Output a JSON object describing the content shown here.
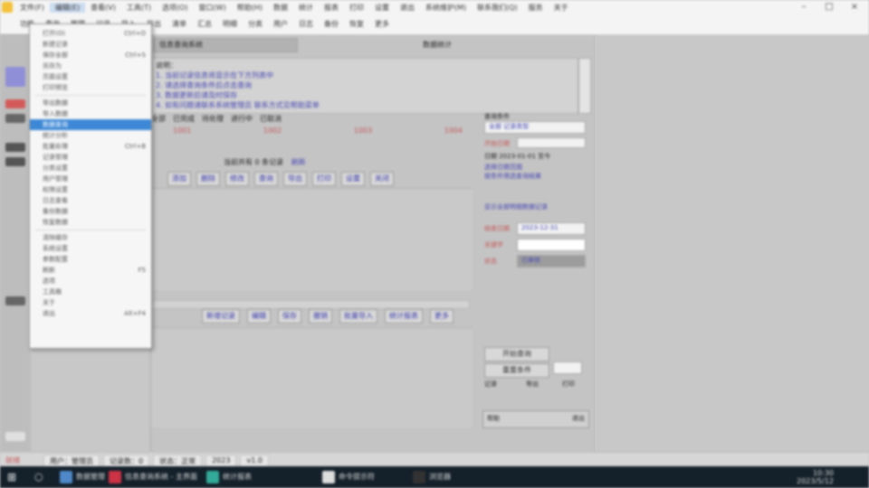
{
  "menubar": {
    "row1": [
      "文件(F)",
      "编辑(E)",
      "查看(V)",
      "工具(T)",
      "选项(O)",
      "窗口(W)",
      "帮助(H)",
      "数据",
      "统计",
      "报表",
      "打印",
      "设置",
      "退出",
      "系统维护(M)",
      "联系我们(Q)",
      "服务",
      "关于"
    ],
    "row2": [
      "功能",
      "查询",
      "管理",
      "记录",
      "导入",
      "导出",
      "清单",
      "汇总",
      "明细",
      "分类",
      "用户",
      "日志",
      "备份",
      "恢复",
      "更多"
    ],
    "selected_index": 1
  },
  "dropdown": {
    "items": [
      {
        "label": "打开(O)",
        "shortcut": "Ctrl+O"
      },
      {
        "label": "新建记录",
        "shortcut": ""
      },
      {
        "label": "保存全部",
        "shortcut": "Ctrl+S"
      },
      {
        "label": "另存为",
        "shortcut": ""
      },
      {
        "label": "页面设置",
        "shortcut": ""
      },
      {
        "label": "打印预览",
        "shortcut": ""
      },
      {
        "label": "导出数据",
        "shortcut": ""
      },
      {
        "label": "导入数据",
        "shortcut": ""
      },
      {
        "label": "数据查询",
        "shortcut": ""
      },
      {
        "label": "统计分析",
        "shortcut": ""
      },
      {
        "label": "批量处理",
        "shortcut": "Ctrl+B"
      },
      {
        "label": "记录管理",
        "shortcut": ""
      },
      {
        "label": "分类设置",
        "shortcut": ""
      },
      {
        "label": "用户管理",
        "shortcut": ""
      },
      {
        "label": "权限设置",
        "shortcut": ""
      },
      {
        "label": "日志查看",
        "shortcut": ""
      },
      {
        "label": "备份数据",
        "shortcut": ""
      },
      {
        "label": "恢复数据",
        "shortcut": ""
      },
      {
        "label": "清除缓存",
        "shortcut": ""
      },
      {
        "label": "系统设置",
        "shortcut": ""
      },
      {
        "label": "参数配置",
        "shortcut": ""
      },
      {
        "label": "刷新",
        "shortcut": "F5"
      },
      {
        "label": "选项",
        "shortcut": ""
      },
      {
        "label": "工具箱",
        "shortcut": ""
      },
      {
        "label": "关于",
        "shortcut": ""
      },
      {
        "label": "退出",
        "shortcut": "Alt+F4"
      }
    ],
    "highlight_index": 8
  },
  "main": {
    "header_title": "信息查询系统",
    "right_header": "数据统计",
    "info_lines": [
      "说明：",
      "1. 当前记录信息将显示在下方列表中",
      "2. 请选择查询条件后点击查询",
      "3. 数据更新后请及时保存",
      "4. 如有问题请联系系统管理员 联系方式见帮助菜单"
    ],
    "row_tabs": [
      "全部",
      "已完成",
      "待处理",
      "进行中",
      "已取消"
    ],
    "row_values": [
      "1001",
      "1002",
      "1003",
      "1004"
    ],
    "center_label": "当前共有 0 条记录",
    "center_link": "刷新",
    "toolbar1": [
      "添加",
      "删除",
      "修改",
      "查询",
      "导出",
      "打印",
      "设置",
      "关闭"
    ],
    "toolbar2": [
      "新增记录",
      "编辑",
      "保存",
      "撤销",
      "批量导入",
      "统计报表",
      "更多"
    ]
  },
  "right_panel": {
    "title": "查询条件",
    "field1_value": "全部 记录类型",
    "label_red1": "开始日期",
    "label_a": "日期 2023-01-01 至今",
    "link_a": "选择日期范围",
    "link_b": "按条件筛选查询结果",
    "link_c": "显示全部明细数据记录",
    "label_red2": "结束日期",
    "value2": "2023-12-31",
    "label_red3": "关键字",
    "label_red4": "状态",
    "value4": "已审核",
    "btn_query": "开始查询",
    "btn_reset": "重置条件",
    "opt1": "记录",
    "opt2": "导出",
    "opt3": "打印",
    "icon_row": [
      "帮助",
      "",
      "",
      "退出"
    ]
  },
  "statusbar": {
    "left": "就绪",
    "segments": [
      "用户：管理员",
      "记录数：0",
      "状态：正常",
      "2023",
      "v1.0"
    ]
  },
  "taskbar": {
    "items": [
      "数据管理",
      "信息查询系统 - 主界面",
      "统计报表",
      "命令提示符",
      "浏览器"
    ],
    "clock_time": "10:30",
    "clock_date": "2023/5/12"
  },
  "colors": {
    "menu_highlight": "#3d88d6",
    "link": "#4646b4",
    "red_label": "#c45858",
    "taskbar": "#14202a"
  }
}
